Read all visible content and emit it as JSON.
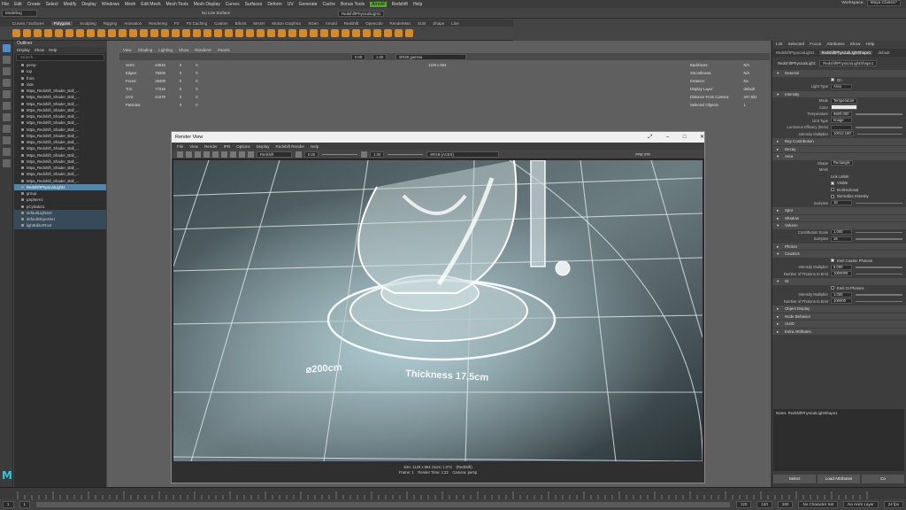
{
  "menubar": {
    "items": [
      "File",
      "Edit",
      "Create",
      "Select",
      "Modify",
      "Display",
      "Windows",
      "Mesh",
      "Edit Mesh",
      "Mesh Tools",
      "Mesh Display",
      "Curves",
      "Surfaces",
      "Deform",
      "UV",
      "Generate",
      "Cache",
      "Bonus Tools",
      "Arnold",
      "Redshift",
      "Help"
    ],
    "highlight_index": 18
  },
  "workspace": {
    "label": "Workspace:",
    "value": "Maya Classic*"
  },
  "status": {
    "mode": "Modeling",
    "live_surface": "No Live Surface",
    "object_name": "RedshiftPhysicalLight1"
  },
  "shelf": {
    "tabs": [
      "Curves / Surfaces",
      "Polygons",
      "Sculpting",
      "Rigging",
      "Animation",
      "Rendering",
      "FX",
      "FX Caching",
      "Custom",
      "Bifrost",
      "MASH",
      "Motion Graphics",
      "XGen",
      "Arnold",
      "Redshift",
      "Opencolo",
      "RenderMan",
      "SUB",
      "Shape",
      "Line"
    ],
    "active_index": 1
  },
  "outliner": {
    "title": "Outliner",
    "menu": [
      "Display",
      "Show",
      "Help"
    ],
    "search_placeholder": "Search...",
    "items": [
      {
        "label": "persp",
        "state": ""
      },
      {
        "label": "top",
        "state": ""
      },
      {
        "label": "front",
        "state": ""
      },
      {
        "label": "side",
        "state": ""
      },
      {
        "label": "Mtpa_Redshift_Shader_Ball_...",
        "state": ""
      },
      {
        "label": "Mtpa_Redshift_Shader_Ball_...",
        "state": ""
      },
      {
        "label": "Mtpa_Redshift_Shader_Ball_...",
        "state": ""
      },
      {
        "label": "Mtpa_Redshift_Shader_Ball_...",
        "state": ""
      },
      {
        "label": "Mtpa_Redshift_Shader_Ball_...",
        "state": ""
      },
      {
        "label": "Mtpa_Redshift_Shader_Ball_...",
        "state": ""
      },
      {
        "label": "Mtpa_Redshift_Shader_Ball_...",
        "state": ""
      },
      {
        "label": "Mtpa_Redshift_Shader_Ball_...",
        "state": ""
      },
      {
        "label": "Mtpa_Redshift_Shader_Ball_...",
        "state": ""
      },
      {
        "label": "Mtpa_Redshift_Shader_Ball_...",
        "state": ""
      },
      {
        "label": "Mtpa_Redshift_Shader_Ball_...",
        "state": ""
      },
      {
        "label": "Mtpa_Redshift_Shader_Ball_...",
        "state": ""
      },
      {
        "label": "Mtpa_Redshift_Shader_Ball_...",
        "state": ""
      },
      {
        "label": "Mtpa_Redshift_Shader_Ball_...",
        "state": ""
      },
      {
        "label": "Mtpa_Redshift_Shader_Ball_...",
        "state": ""
      },
      {
        "label": "RedshiftPhysicalLight1",
        "state": "sel"
      },
      {
        "label": "group",
        "state": ""
      },
      {
        "label": "pSphere1",
        "state": ""
      },
      {
        "label": "pCylinder1",
        "state": ""
      },
      {
        "label": "defaultLightSet",
        "state": "set"
      },
      {
        "label": "defaultObjectSet",
        "state": "set"
      },
      {
        "label": "lightEditorRoot",
        "state": "set"
      }
    ]
  },
  "viewport": {
    "menu": [
      "View",
      "Shading",
      "Lighting",
      "Show",
      "Renderer",
      "Panels"
    ],
    "hud_left": [
      {
        "k": "Verts:",
        "a": "43048",
        "b": "0",
        "c": "0"
      },
      {
        "k": "Edges:",
        "a": "79209",
        "b": "0",
        "c": "0"
      },
      {
        "k": "Faces:",
        "a": "38408",
        "b": "0",
        "c": "0"
      },
      {
        "k": "Tris:",
        "a": "77216",
        "b": "0",
        "c": "0"
      },
      {
        "k": "UVs:",
        "a": "41578",
        "b": "0",
        "c": "0"
      },
      {
        "k": "Particles:",
        "a": "",
        "b": "0",
        "c": "0"
      }
    ],
    "resolution": "1120 x 664",
    "hud_right": [
      {
        "k": "Backfaces:",
        "v": "N/A"
      },
      {
        "k": "Smoothness:",
        "v": "N/A"
      },
      {
        "k": "Instance:",
        "v": "No"
      },
      {
        "k": "Display Layer:",
        "v": "default"
      },
      {
        "k": "Distance From Camera:",
        "v": "347.832"
      },
      {
        "k": "Selected Objects:",
        "v": "1"
      }
    ],
    "toolbar_values": [
      "0.00",
      "1.00"
    ],
    "color_space": "sRGB gamma"
  },
  "render_view": {
    "title": "Render View",
    "menu": [
      "File",
      "View",
      "Render",
      "IPR",
      "Options",
      "Display",
      "Redshift Render",
      "Help"
    ],
    "renderer": "Redshift",
    "exposure": "0.00",
    "gamma": "1.00",
    "colorspace": "sRGB (ACES)",
    "pre_ipr": "PRE IPR",
    "label_diameter": "⌀200cm",
    "label_thickness": "Thickness 17,5cm",
    "footer_line1_a": "size: 1120 x 664 zoom: 1.072",
    "footer_line1_b": "(Redshift)",
    "footer_line2_a": "Frame: 1",
    "footer_line2_b": "Render Time: 1:22",
    "footer_line2_c": "Camera: persp"
  },
  "attribute_editor": {
    "menu": [
      "List",
      "Selected",
      "Focus",
      "Attributes",
      "Show",
      "Help"
    ],
    "tabs": [
      "RedshiftPhysicalLight1",
      "RedshiftPhysicalLightShape1",
      "default"
    ],
    "active_tab": 1,
    "node_type": "RedshiftPhysicalLight:",
    "node_name": "RedshiftPhysicalLightShape1",
    "sections": [
      {
        "type": "section",
        "label": "General",
        "open": true
      },
      {
        "type": "check",
        "label": "On",
        "checked": true
      },
      {
        "type": "field",
        "label": "Light Type",
        "value": "Area"
      },
      {
        "type": "section",
        "label": "Intensity",
        "open": true
      },
      {
        "type": "field",
        "label": "Mode",
        "value": "Temperature"
      },
      {
        "type": "color",
        "label": "Color"
      },
      {
        "type": "slider",
        "label": "Temperature",
        "value": "6500.000"
      },
      {
        "type": "field",
        "label": "Unit Type",
        "value": "Image"
      },
      {
        "type": "slider",
        "label": "Luminous Efficacy (lm/w)",
        "value": ""
      },
      {
        "type": "slider",
        "label": "Intensity Multiplier",
        "value": "10012.180"
      },
      {
        "type": "section",
        "label": "Ray Contribution",
        "open": false
      },
      {
        "type": "section",
        "label": "Decay",
        "open": false
      },
      {
        "type": "section",
        "label": "Area",
        "open": true
      },
      {
        "type": "field",
        "label": "Shape",
        "value": "Rectangle"
      },
      {
        "type": "text",
        "label": "Mesh",
        "value": ""
      },
      {
        "type": "text",
        "label": "",
        "value": "Link         Unlink"
      },
      {
        "type": "check",
        "label": "Visible",
        "checked": true
      },
      {
        "type": "check2",
        "label": "Bi-directional",
        "checked": false
      },
      {
        "type": "check2",
        "label": "Normalize Intensity",
        "checked": false
      },
      {
        "type": "slider",
        "label": "Samples",
        "value": "16"
      },
      {
        "type": "section",
        "label": "Spot",
        "open": false
      },
      {
        "type": "section",
        "label": "Shadow",
        "open": false
      },
      {
        "type": "section",
        "label": "Volume",
        "open": true
      },
      {
        "type": "slider",
        "label": "Contribution Scale",
        "value": "1.000"
      },
      {
        "type": "slider",
        "label": "Samples",
        "value": "16"
      },
      {
        "type": "section",
        "label": "Photon",
        "open": false
      },
      {
        "type": "section",
        "label": "Caustics",
        "open": true
      },
      {
        "type": "check",
        "label": "Emit Caustic Photons",
        "checked": true
      },
      {
        "type": "slider",
        "label": "Intensity Multiplier",
        "value": "5.000"
      },
      {
        "type": "slider",
        "label": "Number of Photons to Emit",
        "value": "1000000"
      },
      {
        "type": "section",
        "label": "GI",
        "open": true
      },
      {
        "type": "check2",
        "label": "Emit GI Photons",
        "checked": false
      },
      {
        "type": "slider",
        "label": "Intensity Multiplier",
        "value": "1.000"
      },
      {
        "type": "slider",
        "label": "Number of Photons to Emit",
        "value": "100000"
      },
      {
        "type": "section",
        "label": "Object Display",
        "open": false
      },
      {
        "type": "section",
        "label": "Node Behavior",
        "open": false
      },
      {
        "type": "section",
        "label": "UUID",
        "open": false
      },
      {
        "type": "section",
        "label": "Extra Attributes",
        "open": false
      }
    ],
    "notes_label": "Notes: RedshiftPhysicalLightShape1",
    "buttons": [
      "Select",
      "Load Attributes",
      "Co"
    ]
  },
  "time_range": {
    "start": "1",
    "current": "1",
    "range_end": "120",
    "end": "120",
    "max": "200",
    "character_set": "No Character Set",
    "anim_layer": "No Anim Layer",
    "fps": "24 fps"
  },
  "logo": "M",
  "colors": {
    "accent": "#5285a6",
    "shelf_icon": "#d58a2a",
    "arnold_highlight": "#5aa832",
    "maya_logo": "#36c4d9"
  }
}
